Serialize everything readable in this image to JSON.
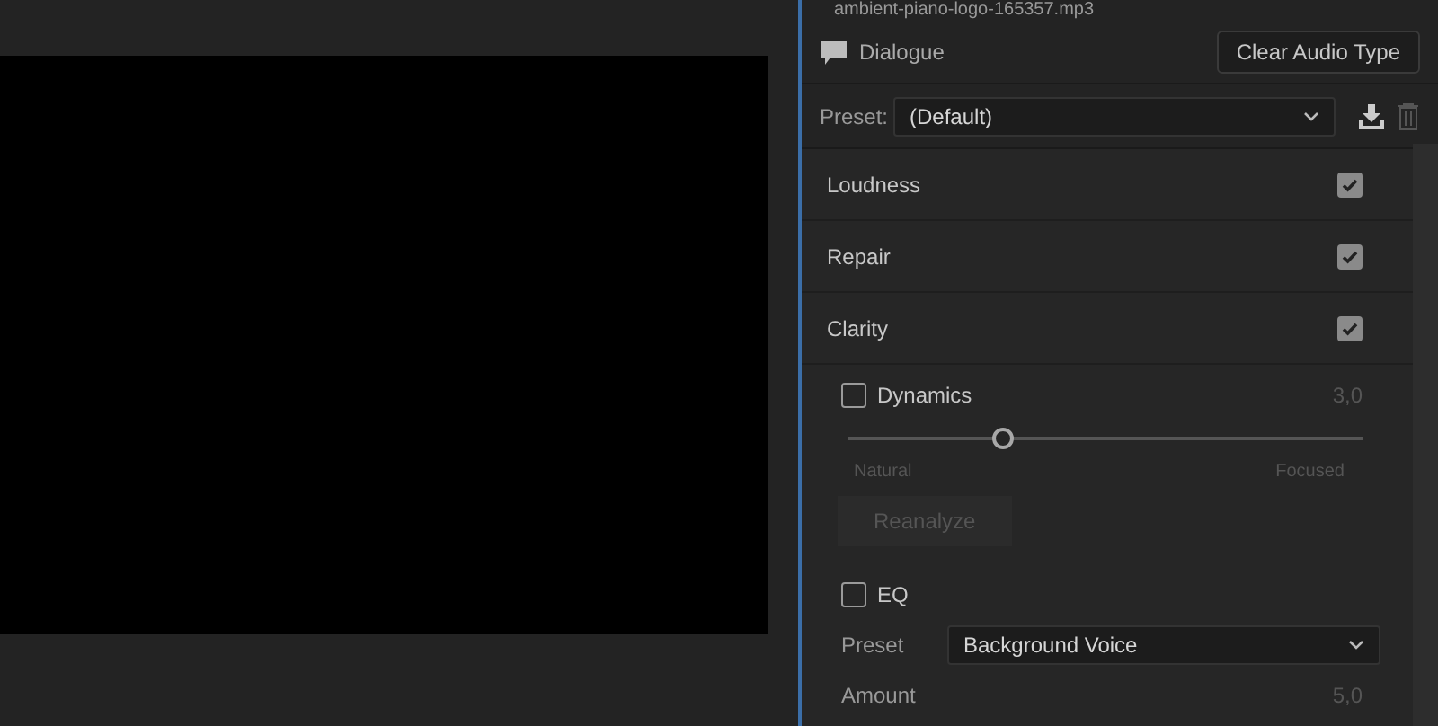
{
  "clip_name": "ambient-piano-logo-165357.mp3",
  "audio_type": {
    "label": "Dialogue",
    "clear_button": "Clear Audio Type"
  },
  "preset": {
    "label": "Preset:",
    "value": "(Default)"
  },
  "sections": [
    {
      "label": "Loudness",
      "checked": true
    },
    {
      "label": "Repair",
      "checked": true
    },
    {
      "label": "Clarity",
      "checked": true
    }
  ],
  "dynamics": {
    "label": "Dynamics",
    "checked": false,
    "reading": "3,0",
    "level": 0.3,
    "min_label": "Natural",
    "max_label": "Focused",
    "button": "Reanalyze",
    "disabled": true
  },
  "eq": {
    "label": "EQ",
    "checked": false,
    "preset_label": "Preset",
    "preset_value": "Background Voice",
    "amount_label": "Amount",
    "amount_reading": "5,0"
  }
}
